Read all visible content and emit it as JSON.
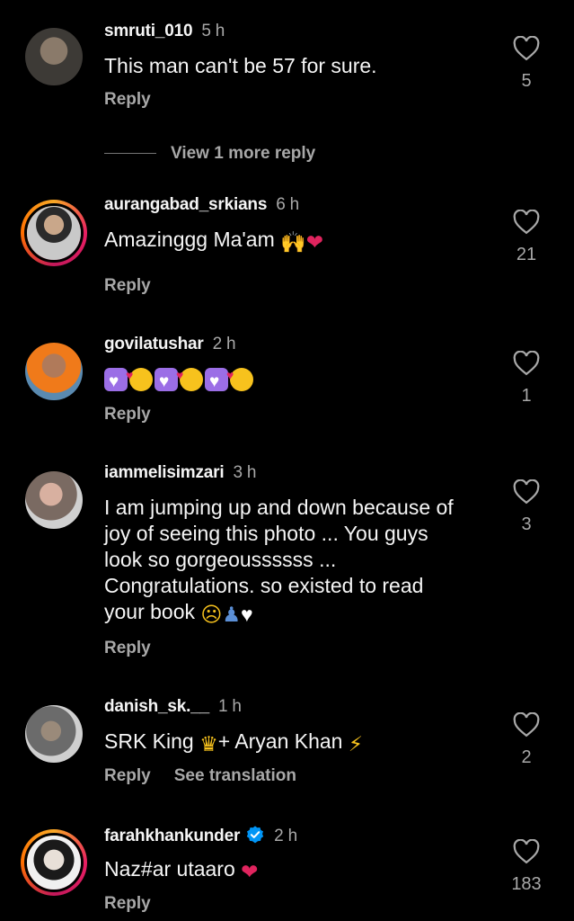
{
  "view_more_replies": "View 1 more reply",
  "comments": [
    {
      "username": "smruti_010",
      "time": "5 h",
      "text": "This man can't be 57 for sure.",
      "likes": "5",
      "actions": [
        "Reply"
      ]
    },
    {
      "username": "aurangabad_srkians",
      "time": "6 h",
      "text": "Amazinggg Ma'am",
      "emoji": [
        "raised-hands",
        "red-heart"
      ],
      "likes": "21",
      "actions": [
        "Reply"
      ]
    },
    {
      "username": "govilatushar",
      "time": "2 h",
      "text": "",
      "emoji": [
        "purple-heart",
        "smiling-face-with-hearts",
        "purple-heart",
        "smiling-face-with-hearts",
        "purple-heart",
        "smiling-face-with-hearts"
      ],
      "likes": "1",
      "actions": [
        "Reply"
      ]
    },
    {
      "username": "iammelisimzari",
      "time": "3 h",
      "text": "I am jumping up and down because of joy of seeing this photo ... You guys look so gorgeoussssss ... Congratulations. so existed to read your book",
      "emoji": [
        "pleading-face",
        "people-hugging",
        "white-heart"
      ],
      "likes": "3",
      "actions": [
        "Reply"
      ]
    },
    {
      "username": "danish_sk.__",
      "time": "1 h",
      "text_parts": [
        "SRK King ",
        "+ Aryan Khan "
      ],
      "emoji": [
        "crown",
        "high-voltage"
      ],
      "likes": "2",
      "actions": [
        "Reply",
        "See translation"
      ]
    },
    {
      "username": "farahkhankunder",
      "verified": true,
      "time": "2 h",
      "text": "Naz#ar utaaro",
      "emoji": [
        "red-heart"
      ],
      "likes": "183",
      "actions": [
        "Reply"
      ]
    }
  ],
  "colors": {
    "background": "#000000",
    "primary_text": "#f5f5f5",
    "secondary_text": "#a8a8a8",
    "verified_blue": "#0095f6",
    "heart": "#e0245e"
  }
}
